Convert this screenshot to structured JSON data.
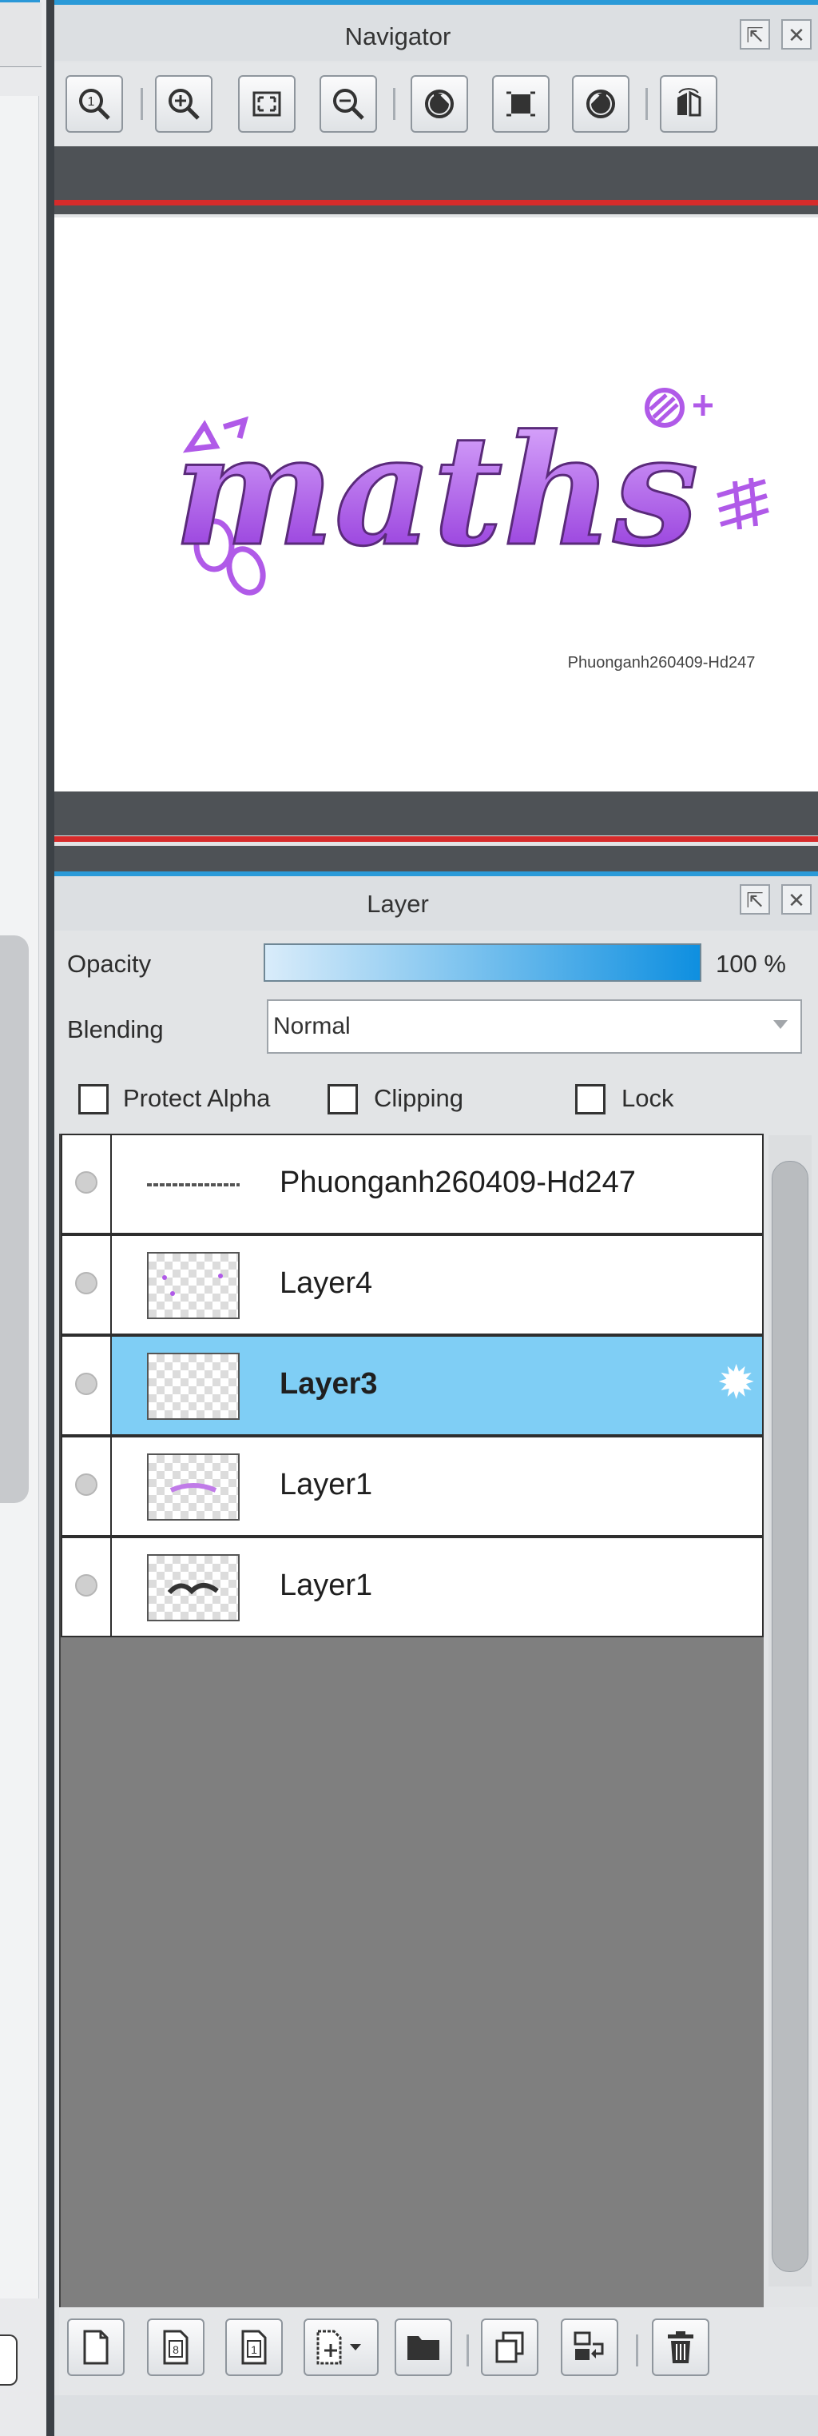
{
  "navigator": {
    "title": "Navigator",
    "canvas": {
      "artwork_text": "maths",
      "signature": "Phuonganh260409-Hd247"
    },
    "toolbar": [
      "zoom-actual-icon",
      "zoom-in-icon",
      "fit-screen-icon",
      "zoom-out-icon",
      "rotate-left-icon",
      "reset-view-icon",
      "rotate-right-icon",
      "flip-horizontal-icon"
    ]
  },
  "layer_panel": {
    "title": "Layer",
    "opacity_label": "Opacity",
    "opacity_value": "100 %",
    "opacity_fraction": 1.0,
    "blending_label": "Blending",
    "blending_value": "Normal",
    "checkboxes": {
      "protect_alpha": "Protect Alpha",
      "clipping": "Clipping",
      "lock": "Lock"
    },
    "layers": [
      {
        "name": "Phuonganh260409-Hd247",
        "selected": false
      },
      {
        "name": "Layer4",
        "selected": false
      },
      {
        "name": "Layer3",
        "selected": true
      },
      {
        "name": "Layer1",
        "selected": false
      },
      {
        "name": "Layer1",
        "selected": false
      }
    ],
    "toolbar": [
      "new-layer-icon",
      "new-8bit-layer-icon",
      "new-1bit-layer-icon",
      "add-special-layer-icon",
      "new-folder-icon",
      "duplicate-layer-icon",
      "merge-down-icon",
      "delete-layer-icon"
    ]
  },
  "colors": {
    "accent_blue": "#2a9ad8",
    "selected_row": "#7fcef5",
    "red_guide": "#d62b2b",
    "art_purple": "#a64de6"
  }
}
